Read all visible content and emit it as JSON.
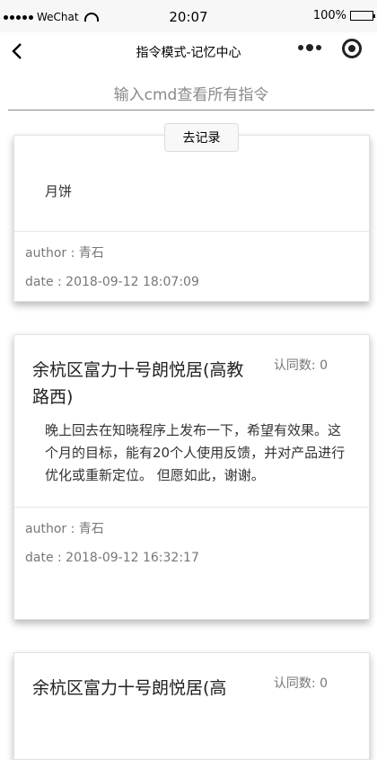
{
  "status_bar": {
    "carrier": "WeChat",
    "time": "20:07",
    "battery": "100%"
  },
  "nav": {
    "title": "指令模式-记忆中心",
    "back_icon": "chevron-left-icon",
    "more_icon": "more-dots-icon",
    "close_icon": "capsule-close-icon"
  },
  "cmd_input": {
    "placeholder": "输入cmd查看所有指令",
    "value": ""
  },
  "go_button": {
    "label": "去记录"
  },
  "cards": [
    {
      "title": "",
      "agree": "",
      "content": "月饼",
      "author": "author : 青石",
      "date": "date : 2018-09-12 18:07:09"
    },
    {
      "title": "余杭区富力十号朗悦居(高教路西)",
      "agree": "认同数: 0",
      "content": "晚上回去在知晓程序上发布一下，希望有效果。这个月的目标，能有20个人使用反馈，并对产品进行优化或重新定位。 但愿如此，谢谢。",
      "author": "author : 青石",
      "date": "date : 2018-09-12 16:32:17"
    },
    {
      "title": "余杭区富力十号朗悦居(高",
      "agree": "认同数: 0",
      "content": "",
      "author": "",
      "date": ""
    }
  ]
}
